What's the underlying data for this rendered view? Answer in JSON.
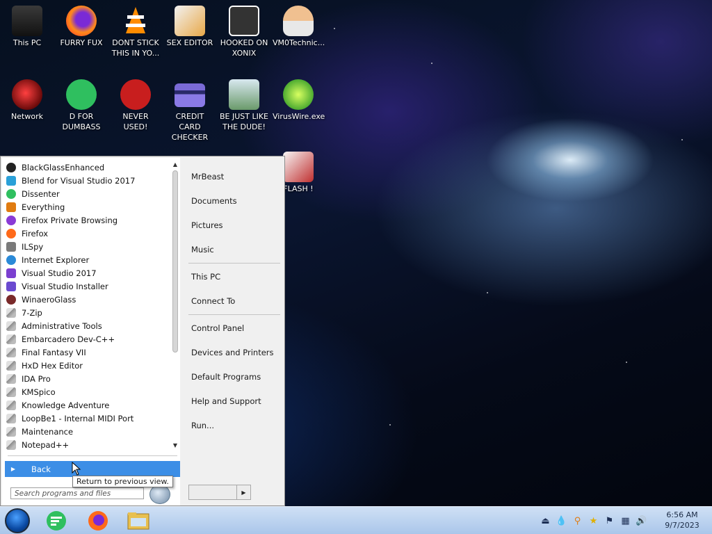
{
  "desktop": {
    "icons": [
      {
        "label": "This PC"
      },
      {
        "label": "FURRY FUX"
      },
      {
        "label": "DONT STICK THIS IN YO..."
      },
      {
        "label": "SEX EDITOR"
      },
      {
        "label": "HOOKED ON XONIX"
      },
      {
        "label": "VM0Technic..."
      },
      {
        "label": "Network"
      },
      {
        "label": "D FOR DUMBASS"
      },
      {
        "label": "NEVER USED!"
      },
      {
        "label": "CREDIT CARD CHECKER"
      },
      {
        "label": "BE JUST LIKE THE DUDE!"
      },
      {
        "label": "VirusWire.exe"
      },
      {
        "label": "FLASH !"
      }
    ]
  },
  "start_menu": {
    "programs": [
      {
        "label": "BlackGlassEnhanced",
        "icon": "black-circle-icon",
        "color": "#222222"
      },
      {
        "label": "Blend for Visual Studio 2017",
        "icon": "blend-icon",
        "color": "#2aa0d8"
      },
      {
        "label": "Dissenter",
        "icon": "dissenter-icon",
        "color": "#2fbf5f"
      },
      {
        "label": "Everything",
        "icon": "magnifier-icon",
        "color": "#e07b10"
      },
      {
        "label": "Firefox Private Browsing",
        "icon": "firefox-private-icon",
        "color": "#8a3ad6"
      },
      {
        "label": "Firefox",
        "icon": "firefox-icon",
        "color": "#ff6a1a"
      },
      {
        "label": "ILSpy",
        "icon": "ilspy-icon",
        "color": "#7a7a7a"
      },
      {
        "label": "Internet Explorer",
        "icon": "ie-icon",
        "color": "#2a8ad8"
      },
      {
        "label": "Visual Studio 2017",
        "icon": "vs-icon",
        "color": "#7b3fd0"
      },
      {
        "label": "Visual Studio Installer",
        "icon": "vs-installer-icon",
        "color": "#6a4ad0"
      },
      {
        "label": "WinaeroGlass",
        "icon": "winaero-icon",
        "color": "#7a2a2a"
      },
      {
        "label": "7-Zip",
        "icon": "folder-icon",
        "color": "#8c8c8c"
      },
      {
        "label": "Administrative Tools",
        "icon": "folder-icon",
        "color": "#8c8c8c"
      },
      {
        "label": "Embarcadero Dev-C++",
        "icon": "folder-icon",
        "color": "#8c8c8c"
      },
      {
        "label": "Final Fantasy VII",
        "icon": "folder-icon",
        "color": "#8c8c8c"
      },
      {
        "label": "HxD Hex Editor",
        "icon": "folder-icon",
        "color": "#8c8c8c"
      },
      {
        "label": "IDA Pro",
        "icon": "folder-icon",
        "color": "#8c8c8c"
      },
      {
        "label": "KMSpico",
        "icon": "folder-icon",
        "color": "#8c8c8c"
      },
      {
        "label": "Knowledge Adventure",
        "icon": "folder-icon",
        "color": "#8c8c8c"
      },
      {
        "label": "LoopBe1 - Internal MIDI Port",
        "icon": "folder-icon",
        "color": "#8c8c8c"
      },
      {
        "label": "Maintenance",
        "icon": "folder-icon",
        "color": "#8c8c8c"
      },
      {
        "label": "Notepad++",
        "icon": "folder-icon",
        "color": "#8c8c8c"
      }
    ],
    "back_label": "Back",
    "back_tooltip": "Return to previous view.",
    "search_placeholder": "Search programs and files",
    "right_items": [
      {
        "label": "MrBeast"
      },
      {
        "label": "Documents"
      },
      {
        "label": "Pictures"
      },
      {
        "label": "Music"
      },
      {
        "label": "This PC"
      },
      {
        "label": "Connect To"
      },
      {
        "label": "Control Panel"
      },
      {
        "label": "Devices and Printers"
      },
      {
        "label": "Default Programs"
      },
      {
        "label": "Help and Support"
      },
      {
        "label": "Run..."
      }
    ],
    "highlight_color": "#3c8ee6"
  },
  "taskbar": {
    "apps": [
      {
        "name": "dissenter-icon"
      },
      {
        "name": "firefox-icon"
      },
      {
        "name": "file-explorer-icon"
      }
    ],
    "tray_icons": [
      "usb-icon",
      "droplet-icon",
      "magnifier-icon",
      "star-icon",
      "flag-icon",
      "network-icon",
      "speaker-icon"
    ],
    "time": "6:56 AM",
    "date": "9/7/2023"
  }
}
